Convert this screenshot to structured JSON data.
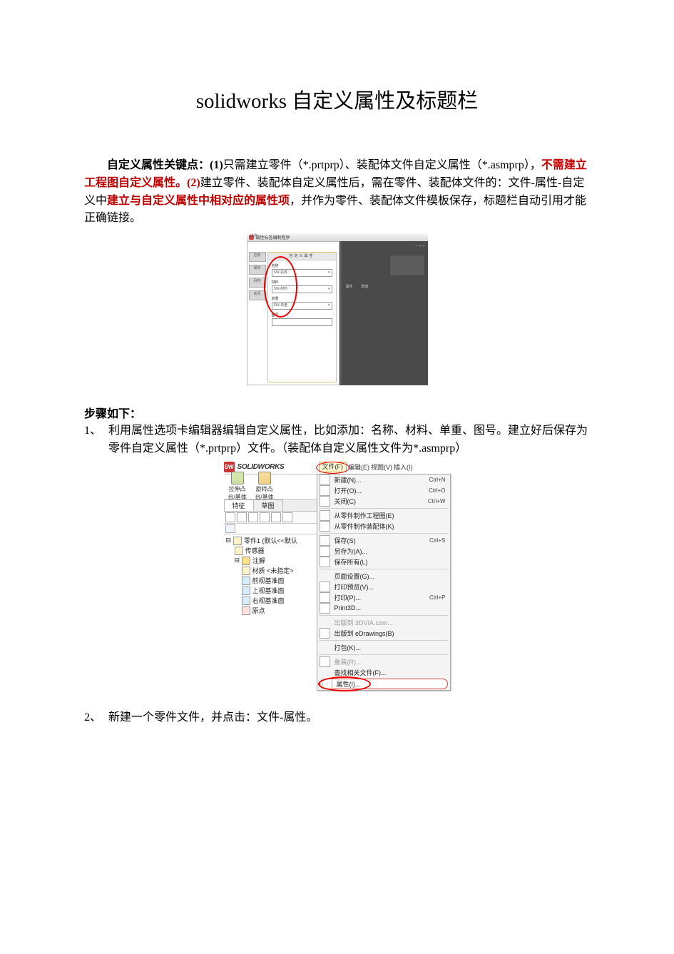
{
  "title": "solidworks 自定义属性及标题栏",
  "intro": {
    "leadBold": "自定义属性关键点：(1)",
    "t1": "只需建立零件（*.prtprp）、装配体文件自定义属性（*.asmprp），",
    "red1": "不需建立工程图自定义属性。(2)",
    "t2": "建立零件、装配体自定义属性后，需在零件、装配体文件的：文件-属性-自定义中",
    "red2": "建立与自定义属性中相对应的属性项",
    "t3": "，并作为零件、装配体文件模板保存，标题栏自动引用才能正确链接。"
  },
  "fig1": {
    "windowTitle": "属性标签编制程序",
    "tabLabel": "设定",
    "header": "自定义属性",
    "sideButtons": [
      "应用",
      "保存",
      "另存",
      "关闭"
    ],
    "fields": [
      {
        "label": "名称",
        "value": "SW-名称",
        "dropdown": true
      },
      {
        "label": "材料",
        "value": "SW-材料",
        "dropdown": true
      },
      {
        "label": "单重",
        "value": "SW-单重",
        "dropdown": true
      },
      {
        "label": "图号",
        "value": "",
        "dropdown": false
      }
    ],
    "rightLabel1": "属性",
    "rightLabel2": "数值",
    "winButtons": "— □ ×"
  },
  "stepsHeading": "步骤如下：",
  "step1": {
    "num": "1、",
    "text": "利用属性选项卡编辑器编辑自定义属性，比如添加：名称、材料、单重、图号。建立好后保存为零件自定义属性（*.prtprp）文件。（装配体自定义属性文件为*.asmprp）"
  },
  "fig2": {
    "brand": "SOLIDWORKS",
    "menubar": [
      "文件(F)",
      "编辑(E)",
      "视图(V)",
      "插入(I)"
    ],
    "toolButtons": [
      {
        "l1": "拉伸凸",
        "l2": "台/基体"
      },
      {
        "l1": "旋转凸",
        "l2": "台/基体"
      }
    ],
    "tabs": [
      "特征",
      "草图"
    ],
    "tree": [
      {
        "name": "零件1 (默认<<默认",
        "indent": 0,
        "open": true
      },
      {
        "name": "传感器",
        "indent": 1
      },
      {
        "name": "注解",
        "indent": 1,
        "open": true
      },
      {
        "name": "材质 <未指定>",
        "indent": 2
      },
      {
        "name": "前视基准面",
        "indent": 2
      },
      {
        "name": "上视基准面",
        "indent": 2
      },
      {
        "name": "右视基准面",
        "indent": 2
      },
      {
        "name": "原点",
        "indent": 2
      }
    ],
    "menu": [
      {
        "label": "新建(N)...",
        "key": "Ctrl+N",
        "icon": true
      },
      {
        "label": "打开(O)...",
        "key": "Ctrl+O",
        "icon": true
      },
      {
        "label": "关闭(C)",
        "key": "Ctrl+W",
        "icon": true
      },
      {
        "sep": true
      },
      {
        "label": "从零件制作工程图(E)",
        "icon": true
      },
      {
        "label": "从零件制作装配体(K)",
        "icon": true
      },
      {
        "sep": true
      },
      {
        "label": "保存(S)",
        "key": "Ctrl+S",
        "icon": true
      },
      {
        "label": "另存为(A)...",
        "icon": true
      },
      {
        "label": "保存所有(L)",
        "icon": true
      },
      {
        "sep": true
      },
      {
        "label": "页面设置(G)...",
        "icon": false
      },
      {
        "label": "打印预览(V)...",
        "icon": true
      },
      {
        "label": "打印(P)...",
        "key": "Ctrl+P",
        "icon": true
      },
      {
        "label": "Print3D...",
        "icon": true
      },
      {
        "sep": true
      },
      {
        "label": "出版到 3DVIA.com...",
        "dis": true
      },
      {
        "label": "出版到 eDrawings(B)",
        "icon": true
      },
      {
        "sep": true
      },
      {
        "label": "打包(K)...",
        "icon": false
      },
      {
        "sep": true
      },
      {
        "label": "重装(R)...",
        "icon": true,
        "dis": true
      },
      {
        "label": "查找相关文件(F)...",
        "icon": false
      },
      {
        "label": "属性(I)...",
        "icon": true,
        "sel": true
      }
    ]
  },
  "step2": {
    "num": "2、",
    "text": "新建一个零件文件，并点击：文件-属性。"
  }
}
